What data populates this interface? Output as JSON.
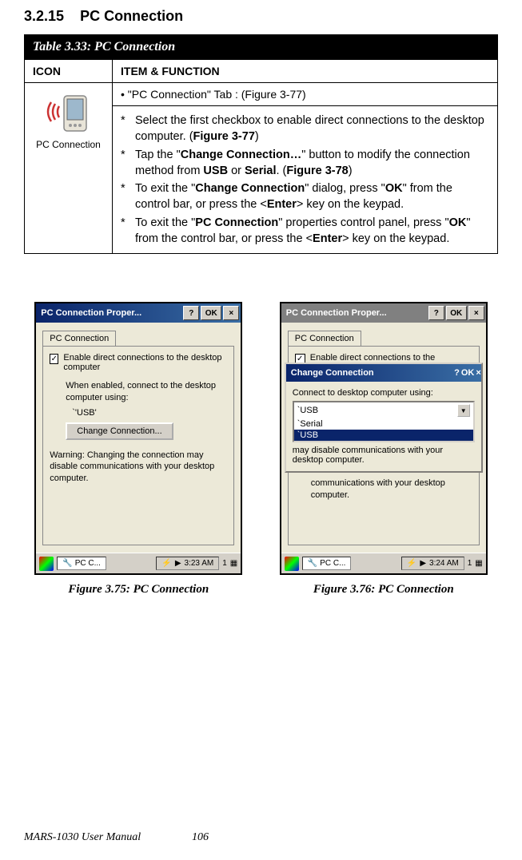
{
  "section": {
    "number": "3.2.15",
    "title": "PC Connection"
  },
  "table": {
    "title": "Table 3.33: PC Connection",
    "col1": "ICON",
    "col2": "ITEM & FUNCTION",
    "tab_label": "•  \"PC Connection\" Tab : (Figure 3-77)",
    "icon_label": "PC Connection",
    "items": [
      "Select the first checkbox to enable direct connections to the desktop computer. (Figure 3-77)",
      "Tap the \"Change Connection…\" button to modify the connection method from USB or Serial. (Figure 3-78)",
      "To exit the \"Change Connection\" dialog, press \"OK\" from the control bar, or press the <Enter> key on the keypad.",
      "To exit the \"PC Connection\" properties control panel, press \"OK\" from the control bar, or press the <Enter> key on the keypad."
    ]
  },
  "screen1": {
    "title": "PC Connection Proper...",
    "help": "?",
    "ok": "OK",
    "close": "×",
    "tab": "PC Connection",
    "chk_label": "Enable direct connections to the desktop computer",
    "conn_text": "When enabled, connect to the desktop computer using:",
    "usb": "`'USB'",
    "change_btn": "Change Connection...",
    "warn": "Warning: Changing the connection may disable communications with your desktop computer.",
    "task": "PC C...",
    "time": "3:23 AM",
    "badge": "1"
  },
  "screen2": {
    "title": "PC Connection Proper...",
    "help": "?",
    "ok": "OK",
    "close": "×",
    "tab": "PC Connection",
    "chk_partial": "Enable direct connections to the",
    "dlg_title": "Change Connection",
    "dlg_label": "Connect to desktop computer using:",
    "opt_sel": "`USB",
    "opt_serial": "`Serial",
    "opt_usb": "`USB",
    "dlg_warn": "may disable communications with your desktop computer.",
    "behind_warn": "communications with your desktop computer.",
    "task": "PC C...",
    "time": "3:24 AM",
    "badge": "1"
  },
  "figures": {
    "left": "Figure 3.75: PC Connection",
    "right": "Figure 3.76: PC Connection"
  },
  "footer": {
    "manual": "MARS-1030 User Manual",
    "page": "106"
  }
}
